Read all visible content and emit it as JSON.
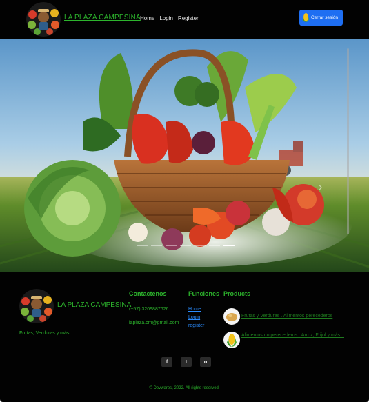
{
  "header": {
    "brand": "LA PLAZA CAMPESINA",
    "nav": [
      {
        "label": "Home"
      },
      {
        "label": "Login"
      },
      {
        "label": "Register"
      }
    ],
    "logout_label": "Cerrar sesión"
  },
  "carousel": {
    "indicator_count": 7,
    "active_index": 6
  },
  "footer": {
    "brand": "LA PLAZA CAMPESINA",
    "tagline": "Frutas, Verduras y más...",
    "contact": {
      "heading": "Contactenos",
      "phone": "(+57) 3209887626",
      "email": "laplaza.cm@gmail.com"
    },
    "functions": {
      "heading": "Funciones",
      "links": [
        "Home",
        "Login",
        "register"
      ]
    },
    "products": {
      "heading": "Products",
      "items": [
        {
          "label": "Frutas y Verduras . Alimentos perecederos",
          "icon": "potato-icon"
        },
        {
          "label": "Alimentos no perecederos . Arroz, Frijol y más...",
          "icon": "corn-icon"
        }
      ]
    },
    "social": [
      {
        "label": "f",
        "icon": "facebook-icon"
      },
      {
        "label": "t",
        "icon": "twitter-icon"
      },
      {
        "label": "o",
        "icon": "instagram-icon"
      }
    ],
    "copyright": "© Devwares, 2022. All rights reserved."
  },
  "colors": {
    "background": "#020202",
    "brand_green": "#2db52d",
    "button_blue": "#1e6ef2",
    "link_blue": "#2a8cff"
  }
}
